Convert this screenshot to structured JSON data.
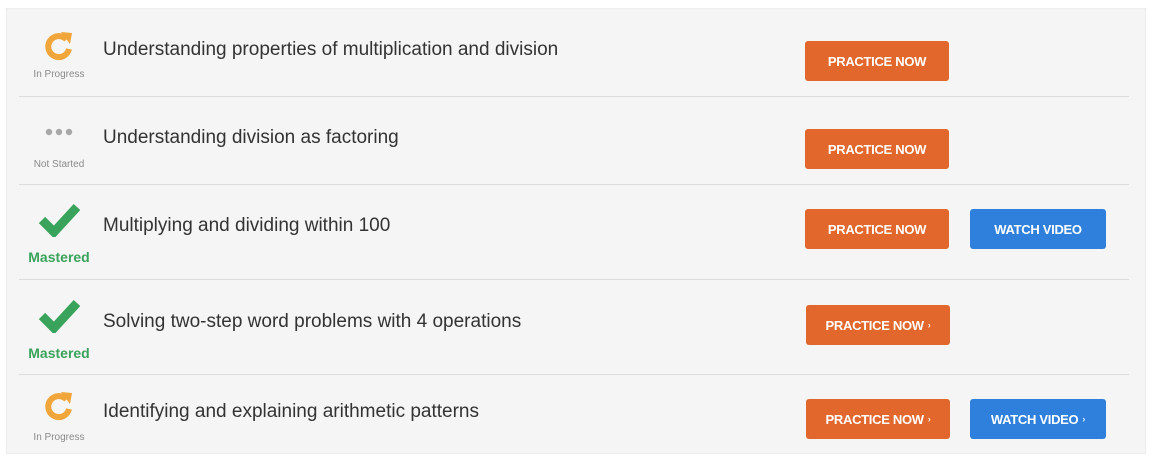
{
  "colors": {
    "in_progress": "#f0a63a",
    "mastered": "#3aa35b",
    "not_started": "#a8a8a8",
    "practice_button": "#e2672c",
    "video_button": "#2f7fdc"
  },
  "skills": [
    {
      "status": "In Progress",
      "status_icon": "refresh-arrow-icon",
      "title": "Understanding properties of multiplication and division",
      "practice_label": "PRACTICE NOW",
      "practice_arrow": "",
      "video_label": "",
      "video_arrow": ""
    },
    {
      "status": "Not Started",
      "status_icon": "three-dots-icon",
      "title": "Understanding division as factoring",
      "practice_label": "PRACTICE NOW",
      "practice_arrow": "",
      "video_label": "",
      "video_arrow": ""
    },
    {
      "status": "Mastered",
      "status_icon": "checkmark-icon",
      "title": "Multiplying and dividing within 100",
      "practice_label": "PRACTICE NOW",
      "practice_arrow": "",
      "video_label": "WATCH VIDEO",
      "video_arrow": ""
    },
    {
      "status": "Mastered",
      "status_icon": "checkmark-icon",
      "title": "Solving two-step word problems with 4 operations",
      "practice_label": "PRACTICE NOW",
      "practice_arrow": "›",
      "video_label": "",
      "video_arrow": ""
    },
    {
      "status": "In Progress",
      "status_icon": "refresh-arrow-icon",
      "title": "Identifying and explaining arithmetic patterns",
      "practice_label": "PRACTICE NOW",
      "practice_arrow": "›",
      "video_label": "WATCH VIDEO",
      "video_arrow": "›"
    }
  ]
}
